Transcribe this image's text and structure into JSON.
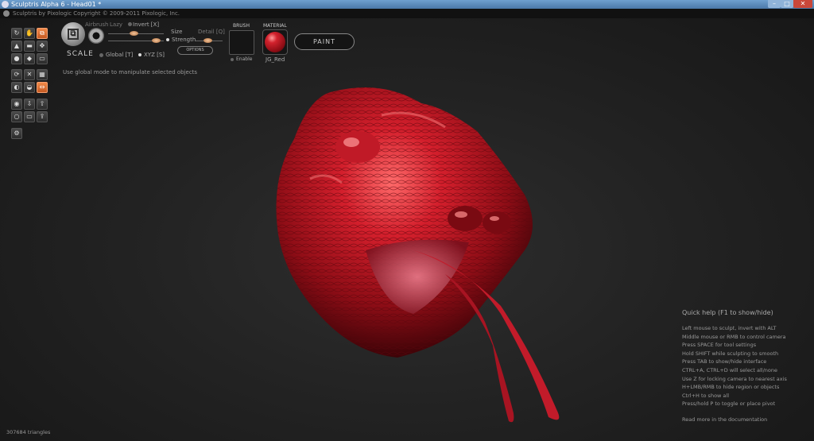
{
  "window": {
    "title": "Sculptris Alpha 6 - Head01 *",
    "minimize": "–",
    "maximize": "□",
    "close": "✕"
  },
  "appbar": {
    "text": "Sculptris by Pixologic   Copyright © 2009-2011 Pixologic, Inc."
  },
  "tools": {
    "current_tool": "SCALE",
    "active_icon": "scale-icon"
  },
  "toolbar": {
    "airbrush": "Airbrush",
    "lazy": "Lazy",
    "invert": "Invert [X]",
    "size": "Size",
    "detail": "Detail [Q]",
    "strength": "Strength",
    "options": "OPTIONS",
    "global": "Global [T]",
    "xyz": "XYZ [S]"
  },
  "brush": {
    "label": "BRUSH",
    "enable": "Enable"
  },
  "material": {
    "label": "MATERIAL",
    "name": "JG_Red",
    "color": "#c81e2a"
  },
  "paint_button": "PAINT",
  "hint": "Use global mode to manipulate selected objects",
  "quick_help": {
    "title": "Quick help (F1 to show/hide)",
    "lines": [
      "Left mouse to sculpt, invert with ALT",
      "Middle mouse or RMB to control camera",
      "Press SPACE for tool settings",
      "Hold SHIFT while sculpting to smooth",
      "Press TAB to show/hide interface",
      "CTRL+A, CTRL+D will select all/none",
      "Use Z for locking camera to nearest axis",
      "H+LMB/RMB to hide region or objects",
      "Ctrl+H to show all",
      "Press/hold P to toggle or place pivot"
    ],
    "more": "Read more in the documentation"
  },
  "status": {
    "triangles": "307684 triangles"
  }
}
